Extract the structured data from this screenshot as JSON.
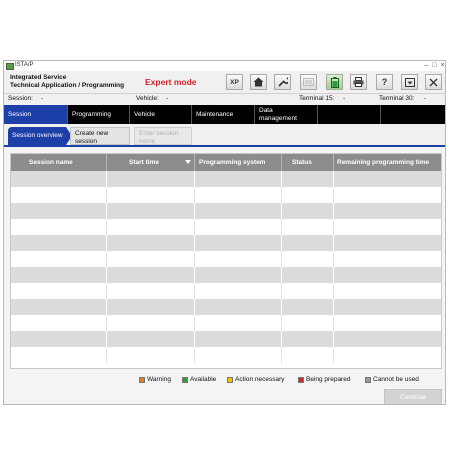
{
  "window": {
    "title": "ISTA/P"
  },
  "header": {
    "app_line1": "Integrated Service",
    "app_line2": "Technical Application / Programming",
    "mode": "Expert mode",
    "toolbar": [
      {
        "name": "xp-button",
        "icon": "XP"
      },
      {
        "name": "home-button",
        "icon": "⌂"
      },
      {
        "name": "wrench-button",
        "icon": "🔧"
      },
      {
        "name": "screen-button",
        "icon": "▭"
      },
      {
        "name": "battery-button",
        "icon": "▮"
      },
      {
        "name": "print-button",
        "icon": "⎙"
      },
      {
        "name": "help-button",
        "icon": "?"
      },
      {
        "name": "minimize-panel-button",
        "icon": "▾"
      },
      {
        "name": "close-app-button",
        "icon": "✕"
      }
    ]
  },
  "status": {
    "session_label": "Session:",
    "session_value": "-",
    "vehicle_label": "Vehicle:",
    "vehicle_value": "-",
    "terminal15_label": "Terminal 15:",
    "terminal15_value": "-",
    "terminal30_label": "Terminal 30:",
    "terminal30_value": "-"
  },
  "nav": {
    "items": [
      "Session",
      "Programming",
      "Vehicle",
      "Maintenance",
      "Data management"
    ]
  },
  "subtabs": {
    "overview": "Session overview",
    "create_line1": "Create new",
    "create_line2": "session",
    "enter_line1": "Enter session",
    "enter_line2": "name"
  },
  "table": {
    "columns": [
      "Session name",
      "Start time",
      "Programming system",
      "Status",
      "Remaining programming time"
    ],
    "rows": 12
  },
  "legend": {
    "warning": "Warning",
    "available": "Available",
    "action": "Action necessary",
    "prepared": "Being prepared",
    "cannot": "Cannot be used"
  },
  "colors": {
    "accent_blue": "#1c3fa8",
    "warning": "#d9822b",
    "available": "#2e9b3e",
    "action": "#f2c200",
    "prepared": "#d62828",
    "cannot": "#9a9a9a",
    "mode_red": "#d2232a"
  },
  "footer": {
    "continue_label": "Continue"
  }
}
